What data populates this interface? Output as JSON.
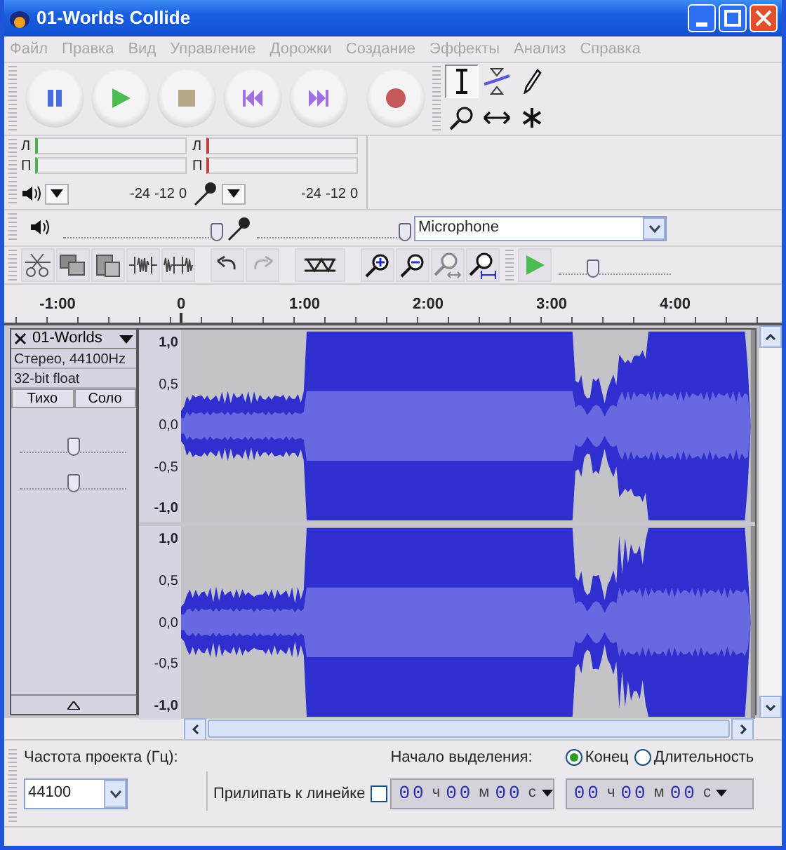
{
  "window": {
    "title": "01-Worlds Collide"
  },
  "menu": [
    "Файл",
    "Правка",
    "Вид",
    "Управление",
    "Дорожки",
    "Создание",
    "Эффекты",
    "Анализ",
    "Справка"
  ],
  "transport": [
    {
      "kind": "pause"
    },
    {
      "kind": "play"
    },
    {
      "kind": "stop"
    },
    {
      "kind": "start"
    },
    {
      "kind": "end"
    },
    {
      "kind": "record"
    }
  ],
  "tools": [
    {
      "kind": "select",
      "selected": true
    },
    {
      "kind": "envelope",
      "selected": false
    },
    {
      "kind": "draw",
      "selected": false
    },
    {
      "kind": "zoom",
      "selected": false
    },
    {
      "kind": "timeshift",
      "selected": false
    },
    {
      "kind": "multi",
      "selected": false
    }
  ],
  "meters": [
    {
      "kind": "speaker",
      "channels": [
        "Л",
        "П"
      ],
      "ticks": [
        "-24",
        "-12",
        "0"
      ]
    },
    {
      "kind": "mic",
      "channels": [
        "Л",
        "П"
      ],
      "ticks": [
        "-24",
        "-12",
        "0"
      ]
    }
  ],
  "mixer": {
    "output": {
      "level": 0.97
    },
    "input": {
      "level": 0.97
    },
    "input_source": "Microphone"
  },
  "edit_tools": [
    {
      "kind": "cut"
    },
    {
      "kind": "copy"
    },
    {
      "kind": "paste"
    },
    {
      "kind": "trim"
    },
    {
      "kind": "silence"
    },
    {
      "kind": "gap"
    },
    {
      "kind": "undo"
    },
    {
      "kind": "redo"
    },
    {
      "kind": "gap"
    },
    {
      "kind": "sync"
    },
    {
      "kind": "gap"
    },
    {
      "kind": "zoomin"
    },
    {
      "kind": "zoomout"
    },
    {
      "kind": "fitsel"
    },
    {
      "kind": "fit"
    }
  ],
  "play_speed": {
    "level": 0.3
  },
  "ruler": {
    "labels": [
      "-1:00",
      "0",
      "1:00",
      "2:00",
      "3:00",
      "4:00"
    ]
  },
  "track": {
    "name": "01-Worlds",
    "info": [
      "Стерео, 44100Hz",
      "32-bit float"
    ],
    "buttons": [
      {
        "label": "Тихо",
        "selected": false
      },
      {
        "label": "Соло",
        "selected": false
      }
    ],
    "gain": {
      "level": 0.5
    },
    "pan": {
      "level": 0.5
    },
    "channels": [
      {
        "scale": [
          "1,0",
          "0,5",
          "0,0",
          "-0,5",
          "-1,0"
        ]
      },
      {
        "scale": [
          "1,0",
          "0,5",
          "0,0",
          "-0,5",
          "-1,0"
        ]
      }
    ]
  },
  "selection_bar": {
    "rate_label": "Частота проекта (Гц):",
    "rate": "44100",
    "snap_label": "Прилипать к линейке",
    "snap_checked": false,
    "start_label": "Начало выделения:",
    "radios": [
      {
        "label": "Конец",
        "selected": true
      },
      {
        "label": "Длительность",
        "selected": false
      }
    ],
    "times": [
      {
        "parts": [
          "00",
          "ч",
          "00",
          "м",
          "00",
          "с"
        ]
      },
      {
        "parts": [
          "00",
          "ч",
          "00",
          "м",
          "00",
          "с"
        ]
      }
    ]
  }
}
